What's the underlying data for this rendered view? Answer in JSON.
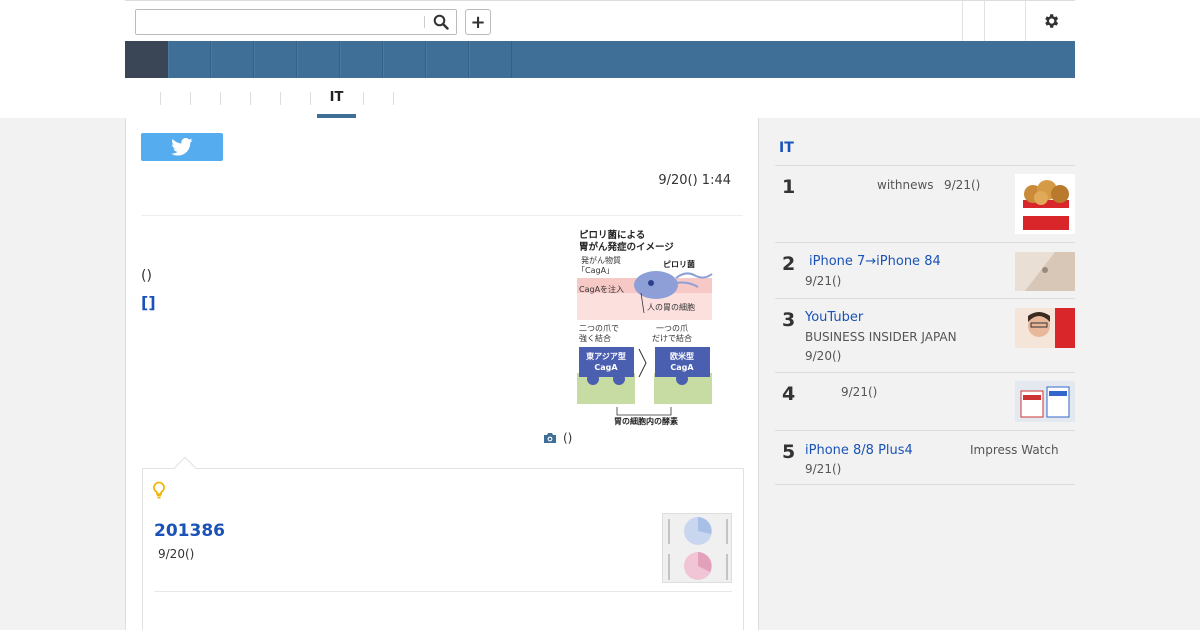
{
  "search": {
    "placeholder": "",
    "value": ""
  },
  "header": {
    "plus_label": "+"
  },
  "subtabs": {
    "active_label": "IT"
  },
  "article": {
    "date": "9/20() 1:44",
    "paren_text": "()",
    "bracket_link": "[]",
    "photo_caption": "()",
    "figure": {
      "title_line1": "ピロリ菌による",
      "title_line2": "胃がん発症のイメージ",
      "label_carcinogen1": "発がん物質",
      "label_carcinogen2": "「CagA」",
      "label_pylori": "ピロリ菌",
      "label_inject": "CagAを注入",
      "label_cell": "人の胃の細胞",
      "label_two_claws1": "二つの爪で",
      "label_two_claws2": "強く結合",
      "label_one_claw1": "一つの爪",
      "label_one_claw2": "だけで結合",
      "label_eastasia1": "東アジア型",
      "label_eastasia2": "CagA",
      "label_western1": "欧米型",
      "label_western2": "CagA",
      "label_enzyme": "胃の細胞内の酵素"
    }
  },
  "related": {
    "title": "201386",
    "date": "9/20()"
  },
  "sidebar": {
    "heading": "IT",
    "ranking": [
      {
        "rank": "1",
        "title": "",
        "source": "withnews",
        "date": "9/21()"
      },
      {
        "rank": "2",
        "title": "iPhone 7→iPhone 84",
        "source": "",
        "date": "9/21()"
      },
      {
        "rank": "3",
        "title": "YouTuber",
        "source": "BUSINESS INSIDER JAPAN",
        "date": "9/20()"
      },
      {
        "rank": "4",
        "title": "",
        "source": "",
        "date": "9/21()"
      },
      {
        "rank": "5",
        "title": "iPhone 8/8 Plus4",
        "source": "Impress Watch",
        "date": "9/21()"
      }
    ]
  },
  "colors": {
    "nav_blue": "#3f6e97",
    "nav_dark": "#3a4656",
    "link_blue": "#1a52b7",
    "twitter_blue": "#55acee",
    "bulb_yellow": "#f0b400"
  },
  "icons": [
    "search-icon",
    "plus-icon",
    "gear-icon",
    "twitter-icon",
    "camera-icon",
    "lightbulb-icon"
  ]
}
